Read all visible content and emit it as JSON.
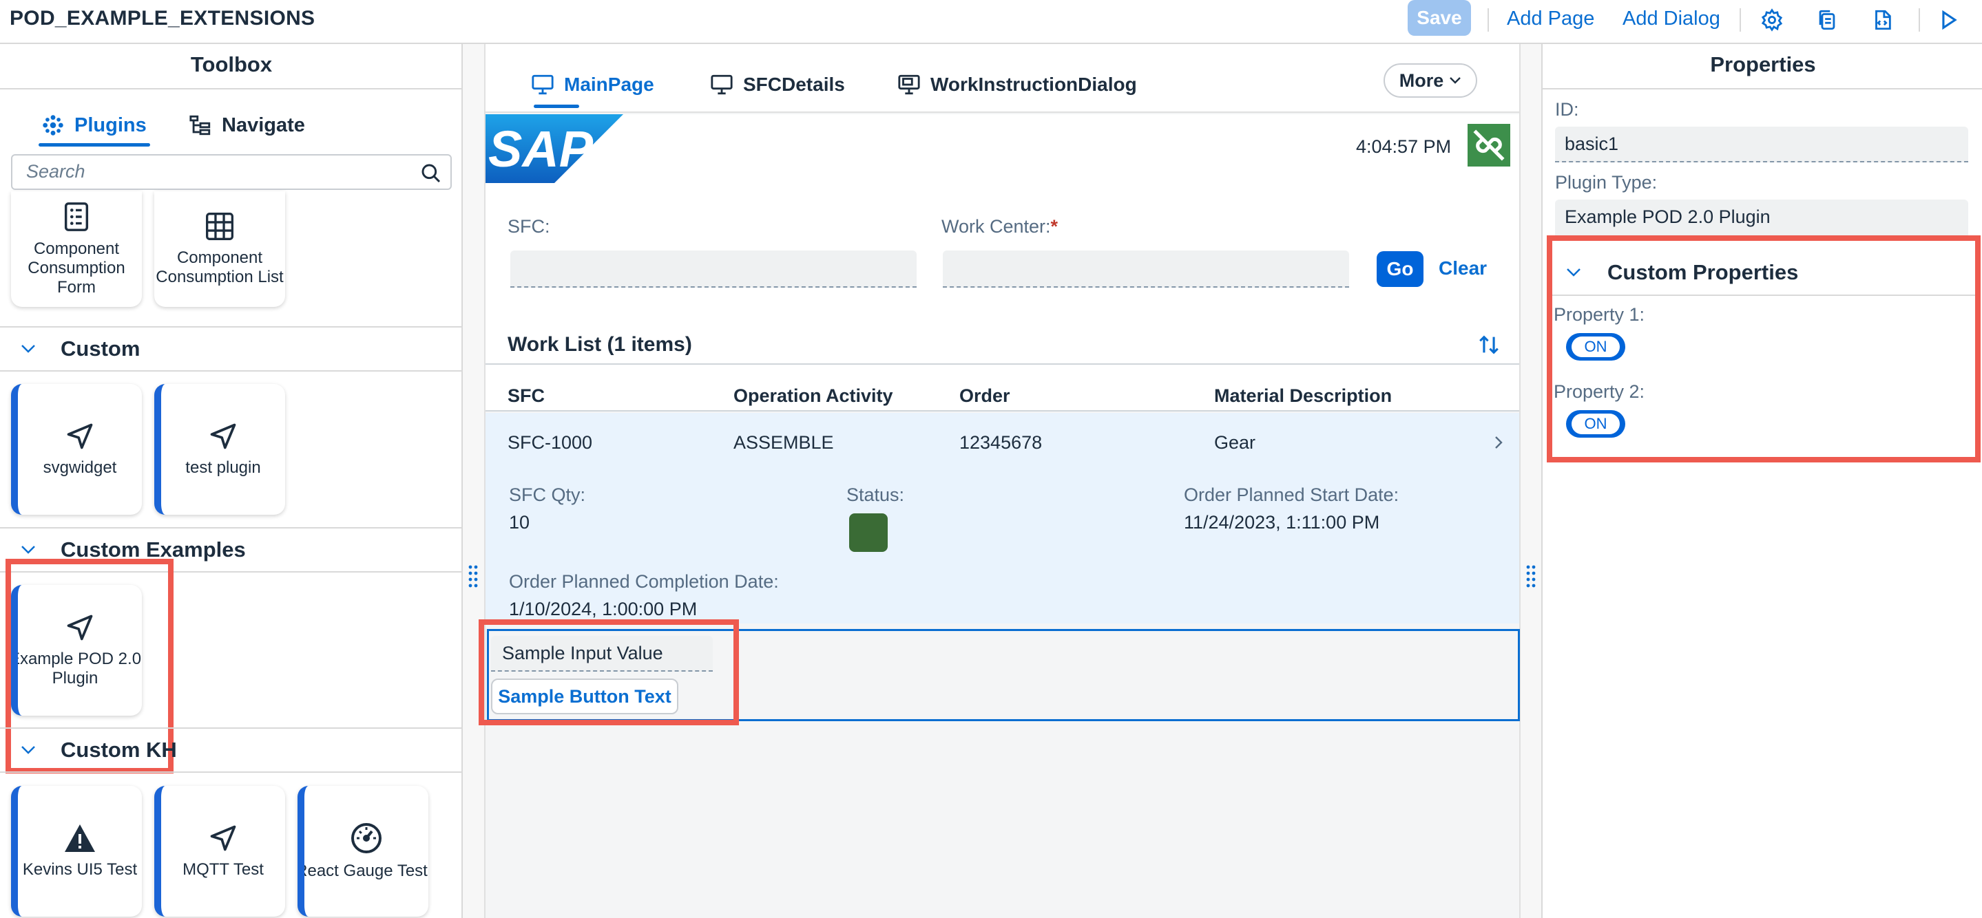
{
  "header": {
    "title": "POD_EXAMPLE_EXTENSIONS",
    "save_label": "Save",
    "add_page_label": "Add Page",
    "add_dialog_label": "Add Dialog"
  },
  "toolbox": {
    "title": "Toolbox",
    "tabs": [
      {
        "label": "Plugins",
        "icon": "plugins-icon"
      },
      {
        "label": "Navigate",
        "icon": "navigate-tree-icon"
      }
    ],
    "search_placeholder": "Search",
    "top_tiles": [
      {
        "label": "Component Consumption Form",
        "icon": "form-icon"
      },
      {
        "label": "Component Consumption List",
        "icon": "grid-icon"
      }
    ],
    "sections": [
      {
        "title": "Custom",
        "tiles": [
          {
            "label": "svgwidget",
            "icon": "navigation-arrow-icon"
          },
          {
            "label": "test plugin",
            "icon": "navigation-arrow-icon"
          }
        ]
      },
      {
        "title": "Custom Examples",
        "tiles": [
          {
            "label": "Example POD 2.0 Plugin",
            "icon": "navigation-arrow-icon"
          }
        ]
      },
      {
        "title": "Custom KH",
        "tiles": [
          {
            "label": "Kevins UI5 Test",
            "icon": "warning-icon"
          },
          {
            "label": "MQTT Test",
            "icon": "navigation-arrow-icon"
          },
          {
            "label": "React Gauge Test",
            "icon": "gauge-icon"
          }
        ]
      }
    ]
  },
  "canvas": {
    "tabs": [
      {
        "label": "MainPage",
        "icon": "monitor-icon",
        "active": true
      },
      {
        "label": "SFCDetails",
        "icon": "monitor-icon",
        "active": false
      },
      {
        "label": "WorkInstructionDialog",
        "icon": "dialog-icon",
        "active": false
      }
    ],
    "more_label": "More",
    "logo_text": "SAP",
    "time": "4:04:57 PM",
    "sfc_label": "SFC:",
    "work_center_label": "Work Center:",
    "required_mark": "*",
    "go_label": "Go",
    "clear_label": "Clear",
    "worklist": {
      "title": "Work List (1 items)",
      "columns": [
        "SFC",
        "Operation Activity",
        "Order",
        "Material Description"
      ],
      "rows": [
        {
          "sfc": "SFC-1000",
          "operation": "ASSEMBLE",
          "order": "12345678",
          "material": "Gear"
        }
      ],
      "details": {
        "sfc_qty_label": "SFC Qty:",
        "sfc_qty_value": "10",
        "status_label": "Status:",
        "status_color": "#3a6b35",
        "planned_start_label": "Order Planned Start Date:",
        "planned_start_value": "11/24/2023, 1:11:00 PM",
        "planned_completion_label": "Order Planned Completion Date:",
        "planned_completion_value": "1/10/2024, 1:00:00 PM"
      }
    },
    "plugin": {
      "input_value": "Sample Input Value",
      "button_label": "Sample Button Text"
    }
  },
  "properties": {
    "title": "Properties",
    "id_label": "ID:",
    "id_value": "basic1",
    "plugin_type_label": "Plugin Type:",
    "plugin_type_value": "Example POD 2.0 Plugin",
    "custom_section_title": "Custom Properties",
    "property1_label": "Property 1:",
    "property1_state": "ON",
    "property2_label": "Property 2:",
    "property2_state": "ON"
  },
  "colors": {
    "accent": "#0a6ed1",
    "highlight_box": "#ee5a4f",
    "status_green": "#3a6b35"
  }
}
